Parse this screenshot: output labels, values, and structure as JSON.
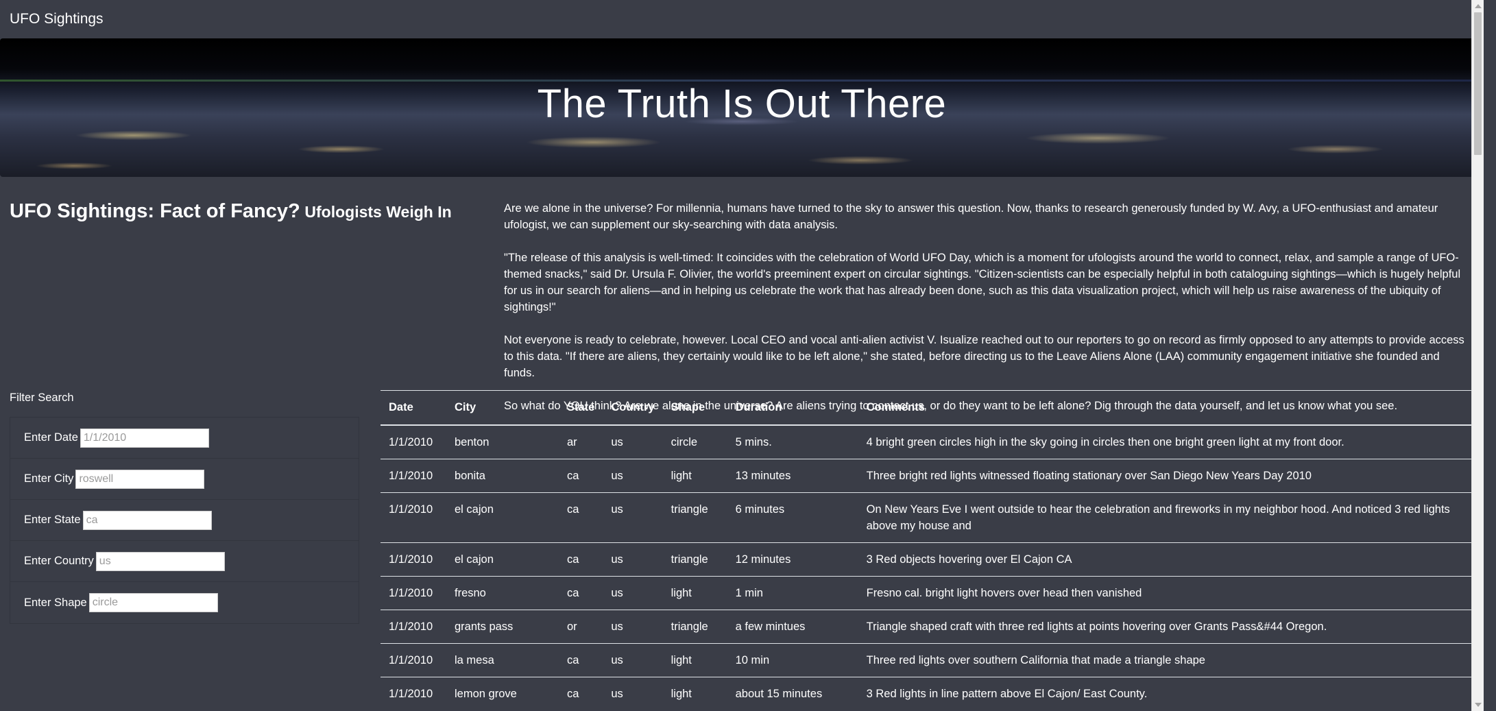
{
  "navbar": {
    "brand": "UFO Sightings"
  },
  "hero": {
    "title": "The Truth Is Out There"
  },
  "article": {
    "title": "UFO Sightings: Fact of Fancy?",
    "subtitle": "Ufologists Weigh In",
    "paragraphs": [
      "Are we alone in the universe? For millennia, humans have turned to the sky to answer this question. Now, thanks to research generously funded by W. Avy, a UFO-enthusiast and amateur ufologist, we can supplement our sky-searching with data analysis.",
      "\"The release of this analysis is well-timed: It coincides with the celebration of World UFO Day, which is a moment for ufologists around the world to connect, relax, and sample a range of UFO-themed snacks,\" said Dr. Ursula F. Olivier, the world's preeminent expert on circular sightings. \"Citizen-scientists can be especially helpful in both cataloguing sightings—which is hugely helpful for us in our search for aliens—and in helping us celebrate the work that has already been done, such as this data visualization project, which will help us raise awareness of the ubiquity of sightings!\"",
      "Not everyone is ready to celebrate, however. Local CEO and vocal anti-alien activist V. Isualize reached out to our reporters to go on record as firmly opposed to any attempts to provide access to this data. \"If there are aliens, they certainly would like to be left alone,\" she stated, before directing us to the Leave Aliens Alone (LAA) community engagement initiative she founded and funds.",
      "So what do YOU think? Are we alone in the universe? Are aliens trying to contact us, or do they want to be left alone? Dig through the data yourself, and let us know what you see."
    ]
  },
  "filters": {
    "heading": "Filter Search",
    "date": {
      "label": "Enter Date",
      "placeholder": "1/1/2010"
    },
    "city": {
      "label": "Enter City",
      "placeholder": "roswell"
    },
    "state": {
      "label": "Enter State",
      "placeholder": "ca"
    },
    "country": {
      "label": "Enter Country",
      "placeholder": "us"
    },
    "shape": {
      "label": "Enter Shape",
      "placeholder": "circle"
    }
  },
  "table": {
    "headers": [
      "Date",
      "City",
      "State",
      "Country",
      "Shape",
      "Duration",
      "Comments"
    ],
    "rows": [
      [
        "1/1/2010",
        "benton",
        "ar",
        "us",
        "circle",
        "5 mins.",
        "4 bright green circles high in the sky going in circles then one bright green light at my front door."
      ],
      [
        "1/1/2010",
        "bonita",
        "ca",
        "us",
        "light",
        "13 minutes",
        "Three bright red lights witnessed floating stationary over San Diego New Years Day 2010"
      ],
      [
        "1/1/2010",
        "el cajon",
        "ca",
        "us",
        "triangle",
        "6 minutes",
        "On New Years Eve I went outside to hear the celebration and fireworks in my neighbor hood. And noticed 3 red lights above my house and"
      ],
      [
        "1/1/2010",
        "el cajon",
        "ca",
        "us",
        "triangle",
        "12 minutes",
        "3 Red objects hovering over El Cajon CA"
      ],
      [
        "1/1/2010",
        "fresno",
        "ca",
        "us",
        "light",
        "1 min",
        "Fresno cal. bright light hovers over head then vanished"
      ],
      [
        "1/1/2010",
        "grants pass",
        "or",
        "us",
        "triangle",
        "a few mintues",
        "Triangle shaped craft with three red lights at points hovering over Grants Pass&#44 Oregon."
      ],
      [
        "1/1/2010",
        "la mesa",
        "ca",
        "us",
        "light",
        "10 min",
        "Three red lights over southern California that made a triangle shape"
      ],
      [
        "1/1/2010",
        "lemon grove",
        "ca",
        "us",
        "light",
        "about 15 minutes",
        "3 Red lights in line pattern above El Cajon/ East County."
      ]
    ]
  }
}
